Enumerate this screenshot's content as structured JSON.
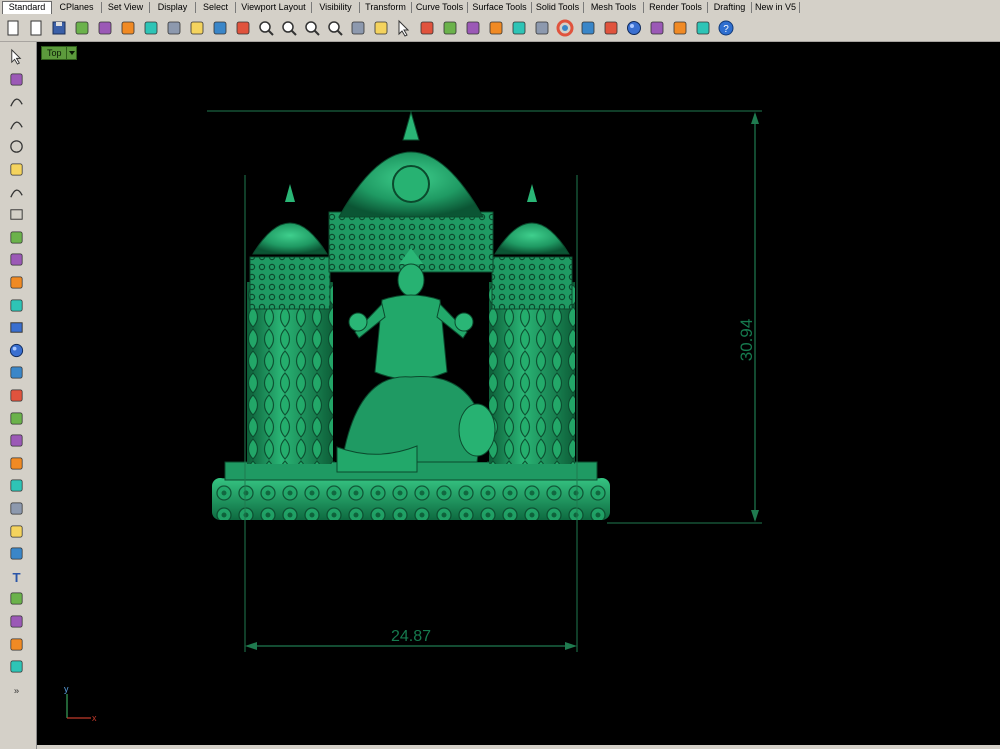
{
  "tabs": [
    "Standard",
    "CPlanes",
    "Set View",
    "Display",
    "Select",
    "Viewport Layout",
    "Visibility",
    "Transform",
    "Curve Tools",
    "Surface Tools",
    "Solid Tools",
    "Mesh Tools",
    "Render Tools",
    "Drafting",
    "New in V5"
  ],
  "active_tab": "Standard",
  "toolbar_icons": [
    "new-file-icon",
    "open-file-icon",
    "save-icon",
    "print-icon",
    "import-icon",
    "cut-icon",
    "copy-icon",
    "paste-icon",
    "undo-icon",
    "pan-icon",
    "rotate-view-icon",
    "zoom-icon",
    "zoom-window-icon",
    "zoom-extents-icon",
    "zoom-selected-icon",
    "rotate-camera-icon",
    "viewports-icon",
    "select-icon",
    "hide-icon",
    "lock-icon",
    "show-icon",
    "light-icon",
    "lock-object-icon",
    "layer-icon",
    "color-icon",
    "render-icon",
    "material-icon",
    "sphere-icon",
    "options-icon",
    "gear-icon",
    "grid-snap-icon",
    "help-icon"
  ],
  "left_toolbar_icons": [
    "select-arrow-icon",
    "point-icon",
    "polyline-icon",
    "curve-icon",
    "circle-icon",
    "ellipse-icon",
    "arc-icon",
    "rectangle-icon",
    "polygon-icon",
    "fillet-icon",
    "surface-icon",
    "extrude-icon",
    "box-icon",
    "sphere-icon",
    "cylinder-icon",
    "edit-surface-icon",
    "explode-icon",
    "transform-icon",
    "analyze-icon",
    "boolean-icon",
    "group-icon",
    "blend-icon",
    "dimension-icon",
    "text-icon",
    "array-icon",
    "snap-icon",
    "properties-icon",
    "solid-icon",
    "more-icon"
  ],
  "viewport": {
    "label": "Top",
    "dimension_vertical": "30.94",
    "dimension_horizontal": "24.87",
    "axis_x": "x",
    "axis_y": "y"
  },
  "colors": {
    "viewport_bg": "#000000",
    "model_green": "#1f9a63",
    "dimension_line": "#1f7a4f",
    "axis_x": "#c0392b",
    "axis_y": "#3aa35a"
  }
}
